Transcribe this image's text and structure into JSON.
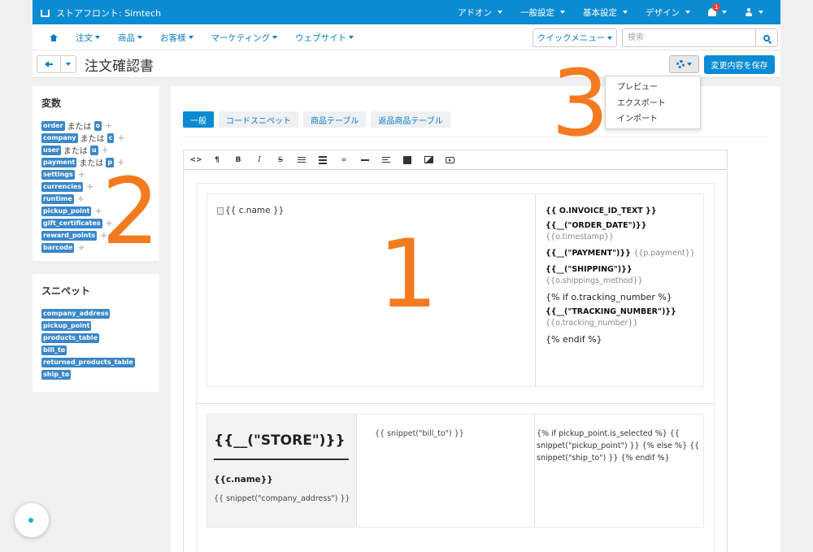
{
  "topbar": {
    "brand": "ストアフロント: Simtech",
    "menu": [
      "アドオン",
      "一般設定",
      "基本設定",
      "デザイン"
    ],
    "notification_count": "1"
  },
  "subnav": {
    "items": [
      "注文",
      "商品",
      "お客様",
      "マーケティング",
      "ウェブサイト"
    ],
    "quick_menu": "クイックメニュー",
    "search_placeholder": "検索"
  },
  "titlebar": {
    "title": "注文確認書",
    "save_label": "変更内容を保存"
  },
  "variables": {
    "heading": "変数",
    "or": "または",
    "items": [
      {
        "name": "order",
        "short": "o"
      },
      {
        "name": "company",
        "short": "c"
      },
      {
        "name": "user",
        "short": "u"
      },
      {
        "name": "payment",
        "short": "p"
      },
      {
        "name": "settings"
      },
      {
        "name": "currencies"
      },
      {
        "name": "runtime"
      },
      {
        "name": "pickup_point"
      },
      {
        "name": "gift_certificates"
      },
      {
        "name": "reward_points"
      },
      {
        "name": "barcode"
      }
    ]
  },
  "snippets": {
    "heading": "スニペット",
    "items": [
      "company_address",
      "pickup_point",
      "products_table",
      "bill_to",
      "returned_products_table",
      "ship_to"
    ]
  },
  "tabs": [
    "一般",
    "コードスニペット",
    "商品テーブル",
    "返品商品テーブル"
  ],
  "dropdown": [
    "プレビュー",
    "エクスポート",
    "インポート"
  ],
  "document": {
    "logo_alt": "{{ c.name }}",
    "invoice_id": "{{ O.INVOICE_ID_TEXT }}",
    "order_date_label": "{{__(\"ORDER_DATE\")}}",
    "timestamp": "{{o.timestamp}}",
    "payment_label": "{{__(\"PAYMENT\")}}",
    "payment_value": "{{p.payment}}",
    "shipping_label": "{{__(\"SHIPPING\")}}",
    "shipping_method": "{{o.shippings_method}}",
    "if_tracking": "{% if o.tracking_number %}",
    "tracking_label": "{{__(\"TRACKING_NUMBER\")}}",
    "tracking_value": "{{o.tracking_number}}",
    "endif": "{% endif %}",
    "store_label": "{{__(\"STORE\")}}",
    "cname": "{{c.name}}",
    "company_address": "{{ snippet(\"company_address\") }}",
    "bill_to": "{{ snippet(\"bill_to\") }}",
    "pickup_logic": "{% if pickup_point.is_selected %} {{ snippet(\"pickup_point\") }} {% else %} {{ snippet(\"ship_to\") }} {% endif %}"
  },
  "annotations": [
    "1",
    "2",
    "3"
  ],
  "colors": {
    "topbar": "#0a8bd2",
    "link": "#0a7bc4",
    "annotation": "#f47a20",
    "tag": "#3a87c9"
  }
}
